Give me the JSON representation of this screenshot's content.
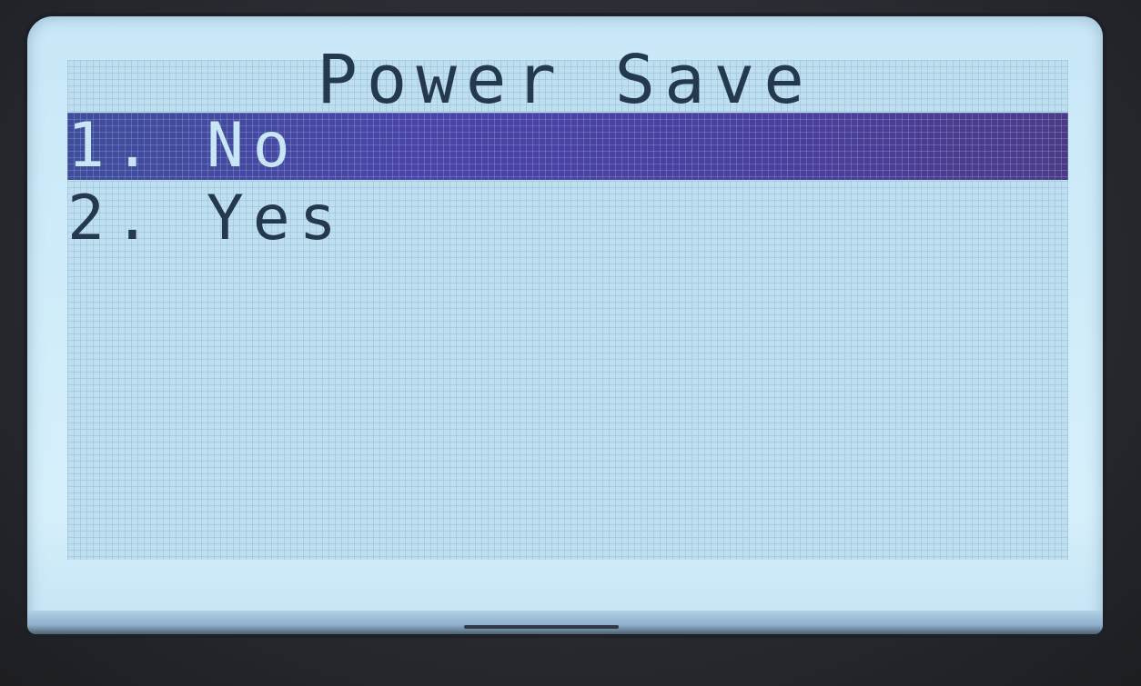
{
  "screen": {
    "title": "Power Save",
    "menu": [
      {
        "label": "1. No",
        "selected": true
      },
      {
        "label": "2. Yes",
        "selected": false
      }
    ]
  },
  "colors": {
    "lcd_background": "#cfecfa",
    "text": "#24394d",
    "selection_bar": "#4a44a8",
    "selected_text": "#c8e6f6"
  }
}
